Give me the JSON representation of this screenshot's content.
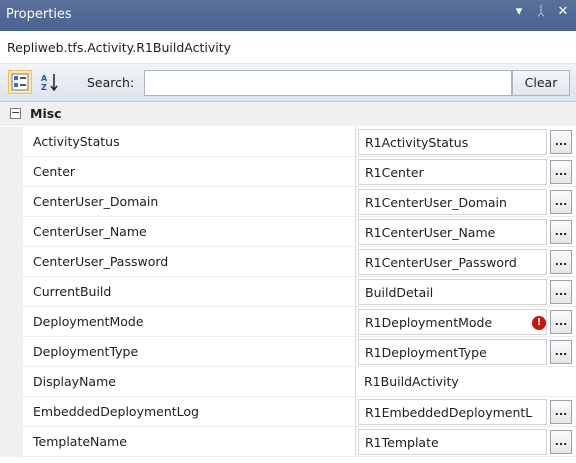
{
  "window": {
    "title": "Properties",
    "controls": {
      "dropdown": "▾",
      "pin": "ᛸ",
      "close": "✕"
    }
  },
  "object_selector": "Repliweb.tfs.Activity.R1BuildActivity",
  "toolbar": {
    "categorized_icon": "categorized-icon",
    "alphabetical_icon": "alphabetical-sort-icon",
    "search_label": "Search:",
    "search_value": "",
    "clear_label": "Clear"
  },
  "category": {
    "toggle": "−",
    "name": "Misc"
  },
  "properties": [
    {
      "name": "ActivityStatus",
      "value": "R1ActivityStatus",
      "editor": true,
      "error": false
    },
    {
      "name": "Center",
      "value": "R1Center",
      "editor": true,
      "error": false
    },
    {
      "name": "CenterUser_Domain",
      "value": "R1CenterUser_Domain",
      "editor": true,
      "error": false
    },
    {
      "name": "CenterUser_Name",
      "value": "R1CenterUser_Name",
      "editor": true,
      "error": false
    },
    {
      "name": "CenterUser_Password",
      "value": "R1CenterUser_Password",
      "editor": true,
      "error": false
    },
    {
      "name": "CurrentBuild",
      "value": "BuildDetail",
      "editor": true,
      "error": false
    },
    {
      "name": "DeploymentMode",
      "value": "R1DeploymentMode",
      "editor": true,
      "error": true
    },
    {
      "name": "DeploymentType",
      "value": "R1DeploymentType",
      "editor": true,
      "error": false
    },
    {
      "name": "DisplayName",
      "value": "R1BuildActivity",
      "editor": false,
      "error": false
    },
    {
      "name": "EmbeddedDeploymentLog",
      "value": "R1EmbeddedDeploymentL",
      "editor": true,
      "error": false
    },
    {
      "name": "TemplateName",
      "value": "R1Template",
      "editor": true,
      "error": false
    }
  ],
  "ellipsis_label": "...",
  "error_glyph": "!",
  "colors": {
    "titlebar": "#4d6593",
    "error": "#cc1111",
    "gutter": "#f0f0f0"
  }
}
